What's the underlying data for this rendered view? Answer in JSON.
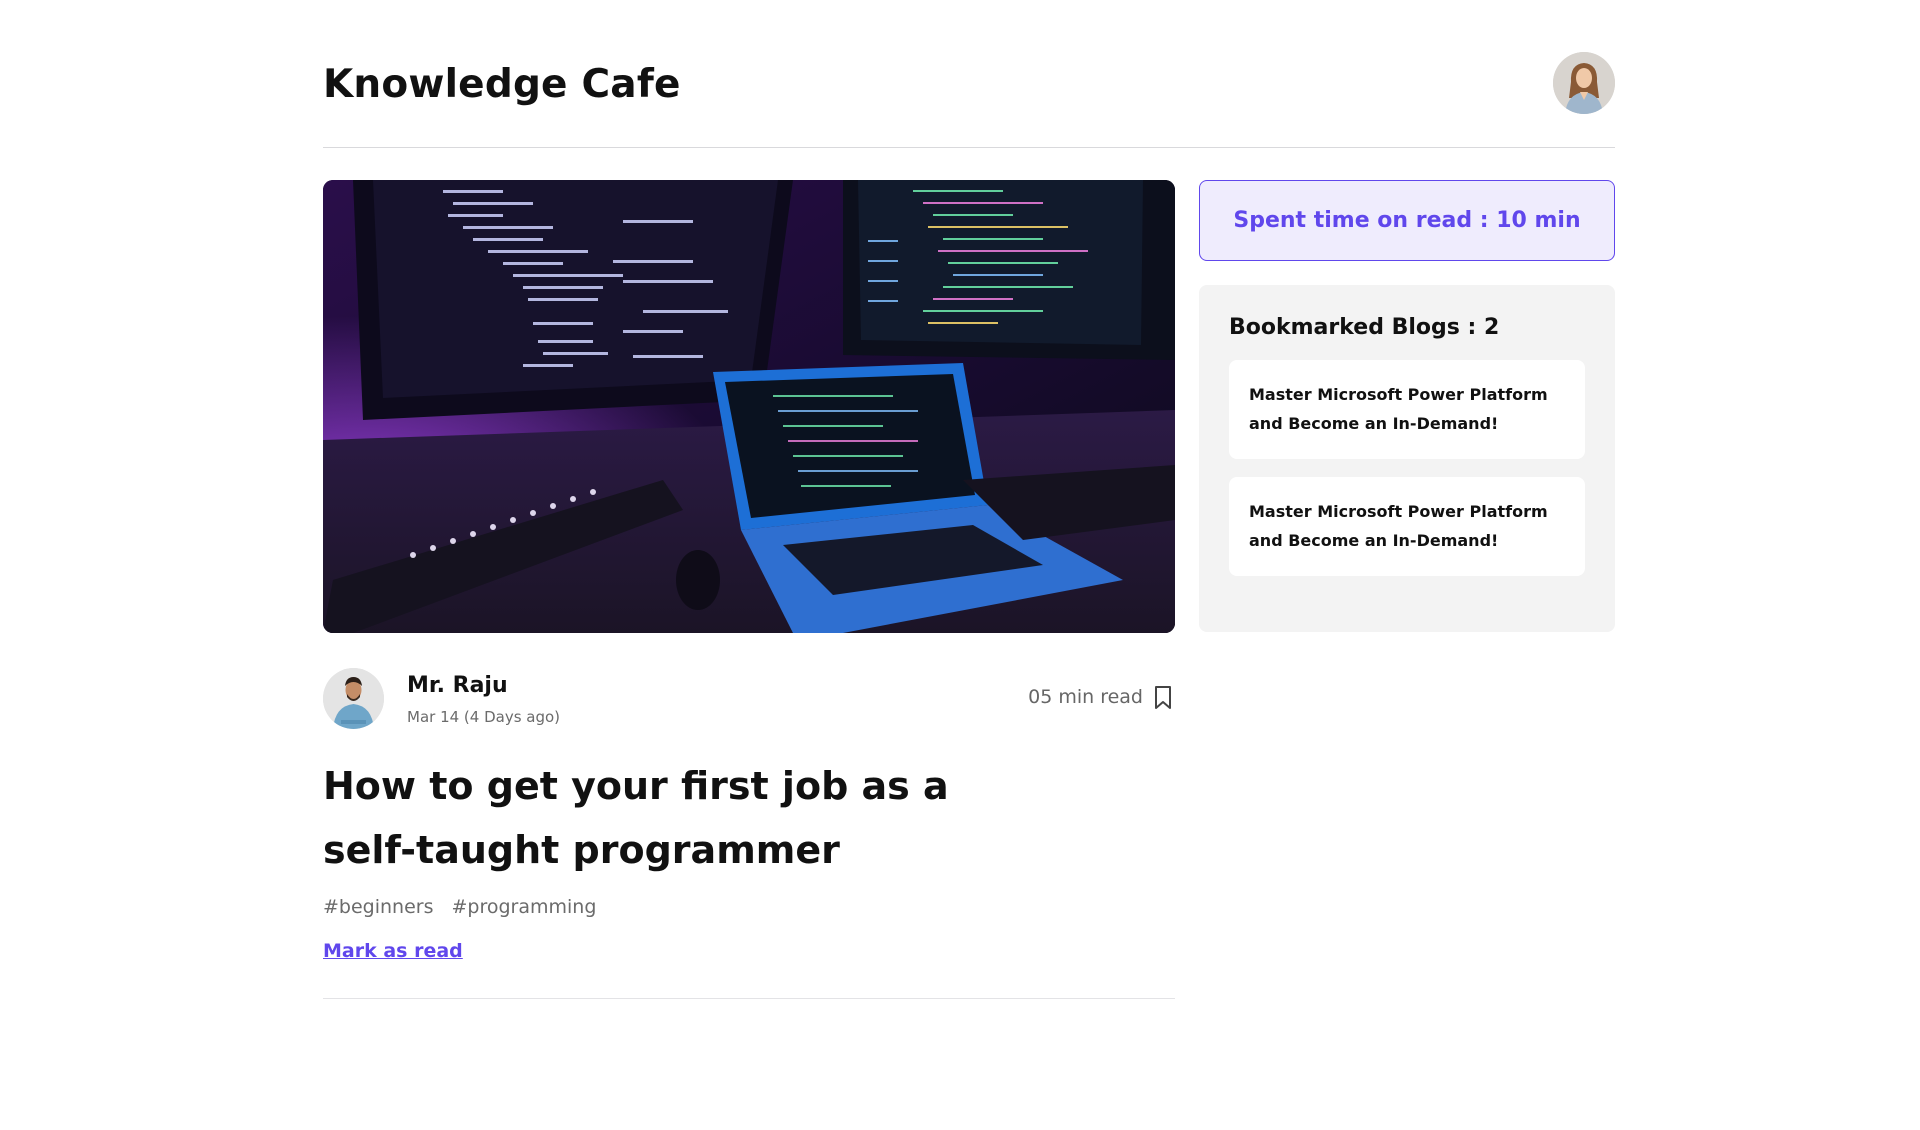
{
  "header": {
    "site_title": "Knowledge Cafe",
    "profile_avatar": "user-avatar-woman"
  },
  "blog": {
    "cover_image": "programmer-desk-photo",
    "author": {
      "name": "Mr. Raju",
      "avatar": "author-avatar-man"
    },
    "date": "Mar 14 (4 Days ago)",
    "read_time": "05 min read",
    "title": "How to get your first job as a self-taught programmer",
    "tags": [
      "#beginners",
      "#programming"
    ],
    "mark_as_read_label": "Mark as read"
  },
  "sidebar": {
    "spent_time_text": "Spent time on read : 10 min",
    "bookmarks_heading": "Bookmarked Blogs : 2",
    "bookmarks": [
      {
        "title": "Master Microsoft Power Platform and Become an In-Demand!"
      },
      {
        "title": "Master Microsoft Power Platform and Become an In-Demand!"
      }
    ]
  },
  "colors": {
    "accent": "#6047ec",
    "accent_bg": "#efecfd",
    "panel_bg": "#f3f3f3",
    "text_muted": "#6b6b6b"
  }
}
